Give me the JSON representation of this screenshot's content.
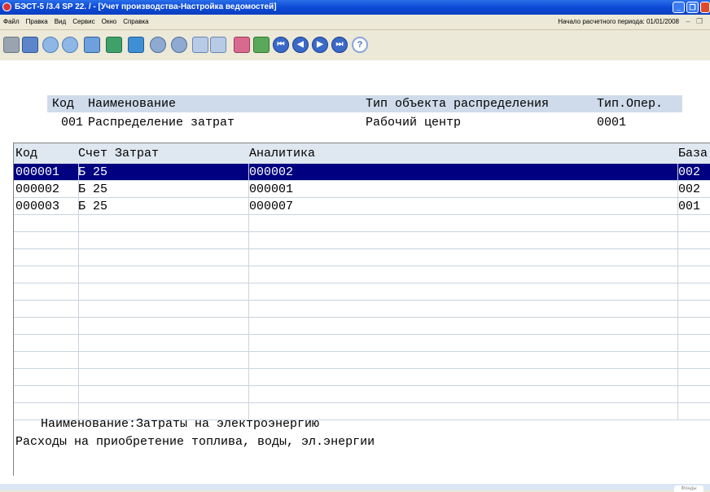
{
  "window": {
    "title": "БЭСТ-5 /3.4 SP 22. / - [Учет производства-Настройка ведомостей]"
  },
  "menu": {
    "items": [
      "Файл",
      "Правка",
      "Вид",
      "Сервис",
      "Окно",
      "Справка"
    ],
    "period_label": "Начало расчетного периода: 01/01/2008"
  },
  "header": {
    "col_kod": "Код",
    "col_name": "Наименование",
    "col_type": "Тип объекта распределения",
    "col_oper": "Тип.Опер.",
    "kod": "001",
    "name": "Распределение затрат",
    "type": "Рабочий центр",
    "oper": "0001"
  },
  "grid": {
    "columns": [
      "Код",
      "Счет Затрат",
      "Аналитика",
      "База"
    ],
    "rows": [
      {
        "kod": "000001",
        "schet": "Б 25",
        "analitika": "000002",
        "baza": "002"
      },
      {
        "kod": "000002",
        "schet": "Б 25",
        "analitika": "000001",
        "baza": "002"
      },
      {
        "kod": "000003",
        "schet": "Б 25",
        "analitika": "000007",
        "baza": "001"
      }
    ],
    "selected_row": 0
  },
  "footer": {
    "line1": "Наименование:Затраты на электроэнергию",
    "line2": "Расходы на приобретение топлива, воды, эл.энергии"
  },
  "statusbar": {
    "bubble": "Фонды"
  },
  "colors": {
    "selection": "#000080",
    "header_band": "#cfdbea",
    "titlebar": "#0d4ad6"
  }
}
